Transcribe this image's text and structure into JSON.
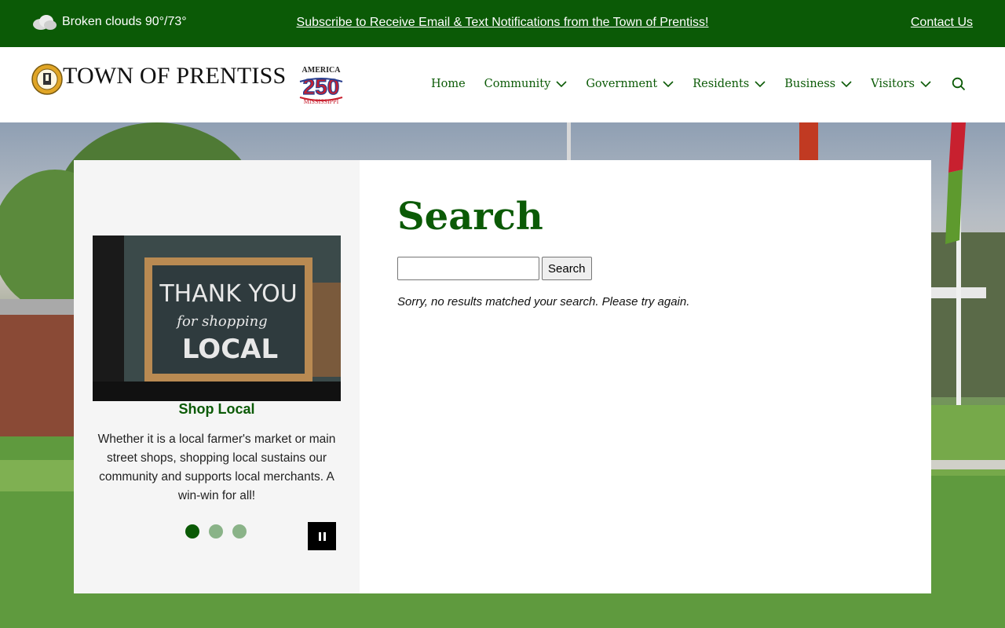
{
  "topbar": {
    "weather": "Broken clouds 90°/73°",
    "subscribe_link": "Subscribe to Receive Email & Text Notifications from the Town of Prentiss!",
    "contact_link": "Contact Us"
  },
  "header": {
    "site_name": "TOWN OF PRENTISS",
    "badge_top": "AMERICA",
    "badge_number": "250",
    "badge_bottom": "MISSISSIPPI",
    "nav": [
      "Home",
      "Community",
      "Government",
      "Residents",
      "Business",
      "Visitors"
    ]
  },
  "slideshow": {
    "image_text_1": "THANK YOU",
    "image_text_2": "for shopping",
    "image_text_3": "LOCAL",
    "title": "Shop Local",
    "text": "Whether it is a local farmer's market or main street shops, shopping local sustains our community and supports local merchants.  A win-win for all!",
    "slide_count": 3,
    "active_slide": 1
  },
  "main": {
    "title": "Search",
    "search_input_value": "",
    "search_button": "Search",
    "message": "Sorry, no results matched your search. Please try again."
  },
  "colors": {
    "brand_green": "#0b5a06",
    "dot_inactive": "#8ab388"
  }
}
